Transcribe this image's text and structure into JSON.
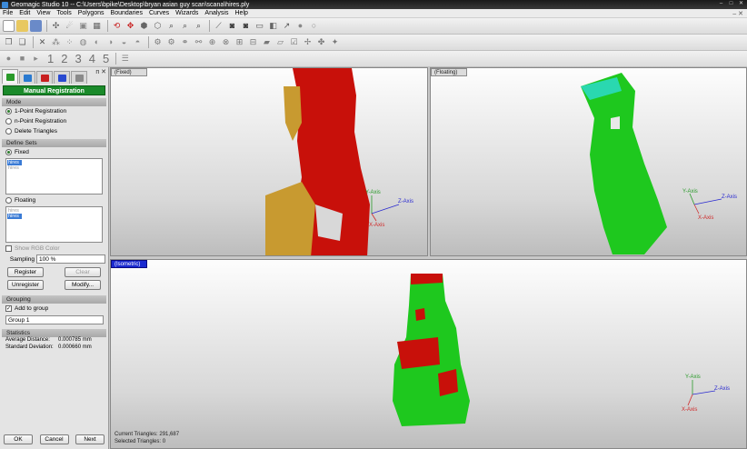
{
  "window": {
    "title": "Geomagic Studio 10 -- C:\\Users\\bpike\\Desktop\\bryan asian guy scan\\scana\\hires.ply",
    "buttons": [
      "–",
      "□",
      "✕"
    ]
  },
  "menu": {
    "items": [
      "File",
      "Edit",
      "View",
      "Tools",
      "Polygons",
      "Boundaries",
      "Curves",
      "Wizards",
      "Analysis",
      "Help"
    ],
    "right_glyph": "– ✕"
  },
  "toolbar3": {
    "numbers": [
      "1",
      "2",
      "3",
      "4",
      "5"
    ]
  },
  "panel": {
    "title": "Manual Registration",
    "pin_glyphs": "ᴨ ✕",
    "mode": {
      "section_label": "Mode",
      "options": [
        "1-Point Registration",
        "n-Point Registration",
        "Delete Triangles"
      ],
      "selected_index": 0
    },
    "define_sets": {
      "section_label": "Define Sets",
      "fixed_label": "Fixed",
      "fixed_items": [
        "hires",
        "hires"
      ],
      "fixed_selected": 0,
      "floating_label": "Floating",
      "floating_items": [
        "hires",
        "hires"
      ],
      "floating_selected": 1
    },
    "show_rgb_label": "Show RGB Color",
    "sampling_label": "Sampling",
    "sampling_value": "100 %",
    "buttons": {
      "register": "Register",
      "clear": "Clear",
      "unregister": "Unregister",
      "modify": "Modify..."
    },
    "grouping": {
      "section_label": "Grouping",
      "add_to_group_label": "Add to group",
      "add_to_group_checked": true,
      "group_name": "Group 1"
    },
    "statistics": {
      "section_label": "Statistics",
      "avg_label": "Average Distance:",
      "avg_value": "0.000785 mm",
      "std_label": "Standard Deviation:",
      "std_value": "0.000660 mm"
    },
    "footer": {
      "ok": "OK",
      "cancel": "Cancel",
      "next": "Next"
    }
  },
  "viewports": {
    "fixed": {
      "label": "(Fixed)"
    },
    "floating": {
      "label": "(Floating)"
    },
    "isometric": {
      "label": "(Isometric)",
      "current_triangles": "Current Triangles: 291,687",
      "selected_triangles": "Selected Triangles: 0"
    },
    "axes": {
      "y": "Y-Axis",
      "z": "Z-Axis",
      "x": "X-Axis"
    }
  },
  "colors": {
    "title_bg": "#1a1a1a",
    "panel_header": "#1a8a2a",
    "selection": "#3a7bd5",
    "model_red": "#c8100a",
    "model_gold": "#c89a30",
    "model_green": "#1ec81e",
    "axis_y": "#2a9a2a",
    "axis_z": "#2a2ad0",
    "axis_x": "#d02a2a"
  }
}
